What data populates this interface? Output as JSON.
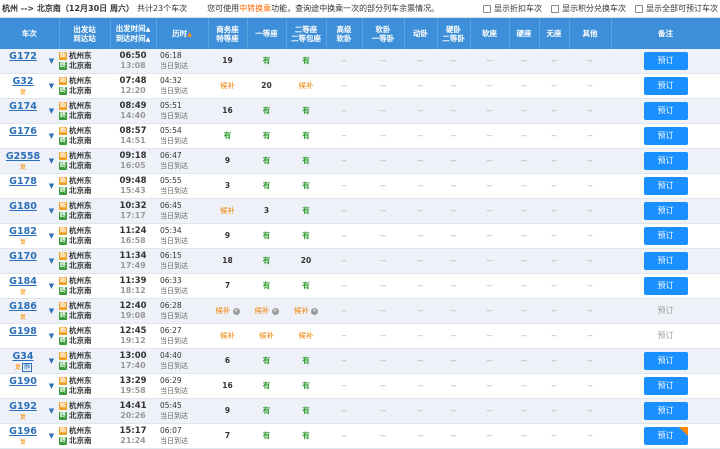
{
  "topbar": {
    "route": "杭州 --> 北京南（12月30日 周六）",
    "total": "共计23个车次",
    "tip_prefix": "您可使用",
    "tip_link": "中转换乘",
    "tip_suffix": "功能，查询途中换乘一次的部分列车余票情况。",
    "opt_discount": "显示折扣车次",
    "opt_points": "显示积分兑换车次",
    "opt_all": "显示全部可预订车次"
  },
  "headers": {
    "train": "车次",
    "station_1": "出发站",
    "station_2": "到达站",
    "time_1": "出发时间",
    "time_2": "到达时间",
    "duration": "历时",
    "business_1": "商务座",
    "business_2": "特等座",
    "first": "一等座",
    "second_1": "二等座",
    "second_2": "二等包座",
    "hs_1": "高级",
    "hs_2": "软卧",
    "soft_1": "软卧",
    "soft_2": "一等卧",
    "dongwo": "动卧",
    "hard_1": "硬卧",
    "hard_2": "二等卧",
    "softseat": "软座",
    "hardseat": "硬座",
    "noseat": "无座",
    "other": "其他",
    "remark": "备注",
    "sort_up": "▲",
    "sort_down": "▼"
  },
  "common": {
    "from": "杭州东",
    "to": "北京南",
    "same_day": "当日到达",
    "dash": "--",
    "book": "预订",
    "start_icon": "始",
    "end_icon": "终",
    "x_icon": "×"
  },
  "trains": [
    {
      "no": "G172",
      "tags": [],
      "dep": "06:50",
      "arr": "13:08",
      "dur": "06:18",
      "biz": "19",
      "first": "有",
      "second": "有",
      "bookable": true
    },
    {
      "no": "G32",
      "tags": [
        "复"
      ],
      "dep": "07:48",
      "arr": "12:20",
      "dur": "04:32",
      "biz": "候补",
      "first": "20",
      "second": "候补",
      "bookable": true
    },
    {
      "no": "G174",
      "tags": [],
      "dep": "08:49",
      "arr": "14:40",
      "dur": "05:51",
      "biz": "16",
      "first": "有",
      "second": "有",
      "bookable": true
    },
    {
      "no": "G176",
      "tags": [],
      "dep": "08:57",
      "arr": "14:51",
      "dur": "05:54",
      "biz": "有",
      "first": "有",
      "second": "有",
      "bookable": true
    },
    {
      "no": "G2558",
      "tags": [
        "复"
      ],
      "dep": "09:18",
      "arr": "16:05",
      "dur": "06:47",
      "biz": "9",
      "first": "有",
      "second": "有",
      "bookable": true
    },
    {
      "no": "G178",
      "tags": [],
      "dep": "09:48",
      "arr": "15:43",
      "dur": "05:55",
      "biz": "3",
      "first": "有",
      "second": "有",
      "bookable": true
    },
    {
      "no": "G180",
      "tags": [],
      "dep": "10:32",
      "arr": "17:17",
      "dur": "06:45",
      "biz": "候补",
      "first": "3",
      "second": "有",
      "bookable": true
    },
    {
      "no": "G182",
      "tags": [
        "复"
      ],
      "dep": "11:24",
      "arr": "16:58",
      "dur": "05:34",
      "biz": "9",
      "first": "有",
      "second": "有",
      "bookable": true
    },
    {
      "no": "G170",
      "tags": [],
      "dep": "11:34",
      "arr": "17:49",
      "dur": "06:15",
      "biz": "18",
      "first": "有",
      "second": "20",
      "bookable": true
    },
    {
      "no": "G184",
      "tags": [
        "复"
      ],
      "dep": "11:39",
      "arr": "18:12",
      "dur": "06:33",
      "biz": "7",
      "first": "有",
      "second": "有",
      "bookable": true
    },
    {
      "no": "G186",
      "tags": [
        "复"
      ],
      "dep": "12:40",
      "arr": "19:08",
      "dur": "06:28",
      "biz": "候补",
      "first": "候补",
      "second": "候补",
      "bookable": false,
      "x": true
    },
    {
      "no": "G198",
      "tags": [],
      "dep": "12:45",
      "arr": "19:12",
      "dur": "06:27",
      "biz": "候补",
      "first": "候补",
      "second": "候补",
      "bookable": false
    },
    {
      "no": "G34",
      "tags": [
        "复",
        "静"
      ],
      "dep": "13:00",
      "arr": "17:40",
      "dur": "04:40",
      "biz": "6",
      "first": "有",
      "second": "有",
      "bookable": true
    },
    {
      "no": "G190",
      "tags": [],
      "dep": "13:29",
      "arr": "19:58",
      "dur": "06:29",
      "biz": "16",
      "first": "有",
      "second": "有",
      "bookable": true
    },
    {
      "no": "G192",
      "tags": [
        "复"
      ],
      "dep": "14:41",
      "arr": "20:26",
      "dur": "05:45",
      "biz": "9",
      "first": "有",
      "second": "有",
      "bookable": true
    },
    {
      "no": "G196",
      "tags": [
        "复"
      ],
      "dep": "15:17",
      "arr": "21:24",
      "dur": "06:07",
      "biz": "7",
      "first": "有",
      "second": "有",
      "bookable": true,
      "corner": true
    }
  ]
}
